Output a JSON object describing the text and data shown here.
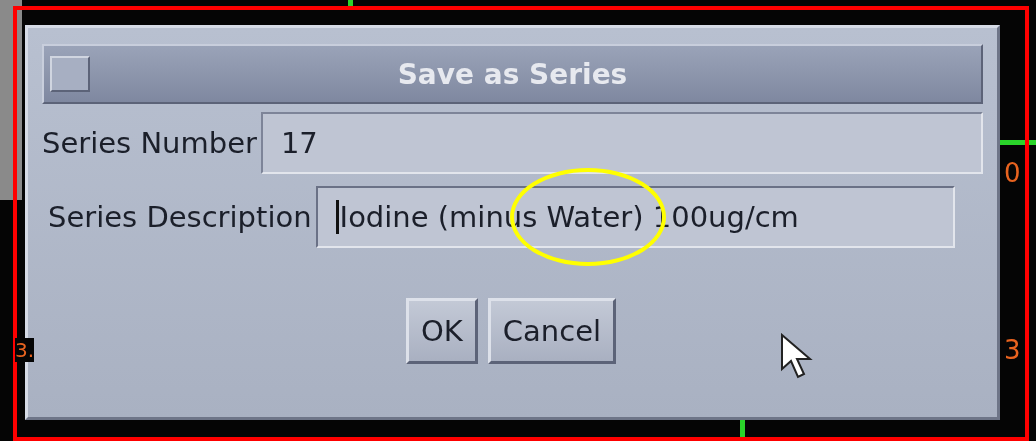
{
  "dialog": {
    "title": "Save as Series",
    "fields": [
      {
        "label": "Series Number",
        "value": "17",
        "focused": false
      },
      {
        "label": "Series Description",
        "value": "Iodine (minus Water) 100ug/cm",
        "focused": true
      }
    ],
    "buttons": [
      "OK",
      "Cancel"
    ]
  },
  "left_labels": [
    "3."
  ],
  "right_labels": [
    "0",
    "3"
  ],
  "annotations": [
    {
      "kind": "frame",
      "color": "#ff0000"
    },
    {
      "kind": "ellipse",
      "color": "#ffff00"
    }
  ]
}
